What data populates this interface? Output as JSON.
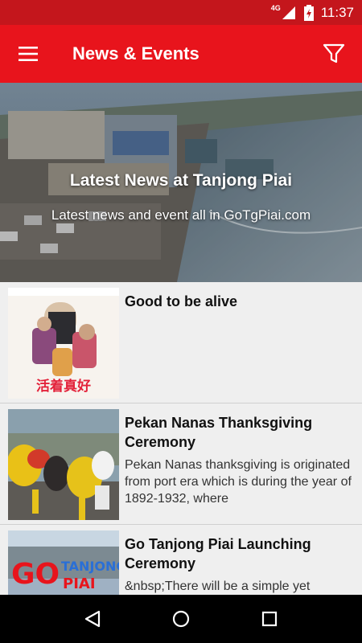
{
  "status_bar": {
    "network": "4G",
    "time": "11:37"
  },
  "app_bar": {
    "title": "News & Events",
    "menu_icon": "hamburger-menu-icon",
    "filter_icon": "filter-funnel-icon"
  },
  "banner": {
    "title": "Latest News at Tanjong Piai",
    "subtitle": "Latest news and event all in GoTgPiai.com"
  },
  "news": [
    {
      "title": "Good to be alive",
      "description": ""
    },
    {
      "title": "Pekan Nanas Thanksgiving Ceremony",
      "description": "Pekan Nanas thanksgiving is originated from port era which is during the year of 1892-1932, where"
    },
    {
      "title": "Go Tanjong Piai Launching Ceremony",
      "description": "&nbsp;There will be a simple yet"
    }
  ],
  "thumbs": {
    "poster_text": "活着真好",
    "go_text": "GO",
    "tanjong_text": "TANJONG",
    "piai_text": "PIAI"
  },
  "colors": {
    "status_bar": "#c4161c",
    "app_bar": "#e8141c"
  },
  "nav_bar": {
    "back_icon": "back-triangle-icon",
    "home_icon": "home-circle-icon",
    "recents_icon": "recents-square-icon"
  }
}
